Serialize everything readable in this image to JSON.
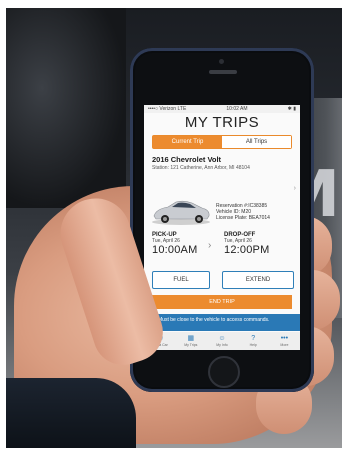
{
  "status_bar": {
    "carrier": "••••○ Verizon  LTE",
    "time": "10:02 AM",
    "battery": "✱ ▮"
  },
  "app": {
    "title": "MY TRIPS",
    "tabs": [
      {
        "label": "Current Trip",
        "active": true
      },
      {
        "label": "All Trips",
        "active": false
      }
    ]
  },
  "trip": {
    "car": "2016 Chevrolet Volt",
    "station": "Station: 121 Catherine, Ann Arbor, MI 48104",
    "reservation": "Reservation #:IC38385",
    "vehicle_id": "Vehicle ID: M20",
    "license": "License Plate: BEA7014",
    "pickup": {
      "label": "PICK-UP",
      "date": "Tue, April 26",
      "time": "10:00AM"
    },
    "dropoff": {
      "label": "DROP-OFF",
      "date": "Tue, April 26",
      "time": "12:00PM"
    }
  },
  "buttons": {
    "fuel": "FUEL",
    "extend": "EXTEND",
    "end_trip": "END TRIP"
  },
  "warning": "Must be close to the vehicle to access commands.",
  "nav": [
    {
      "label": "Find a Car",
      "icon": "map-pin-icon",
      "glyph": "⦿"
    },
    {
      "label": "My Trips",
      "icon": "calendar-icon",
      "glyph": "▦"
    },
    {
      "label": "My Info",
      "icon": "person-icon",
      "glyph": "☺"
    },
    {
      "label": "Help",
      "icon": "help-icon",
      "glyph": "?"
    },
    {
      "label": "More",
      "icon": "more-icon",
      "glyph": "•••"
    }
  ],
  "background_letter": "M",
  "colors": {
    "accent": "#ec8b2f",
    "blue": "#2a79b6"
  }
}
